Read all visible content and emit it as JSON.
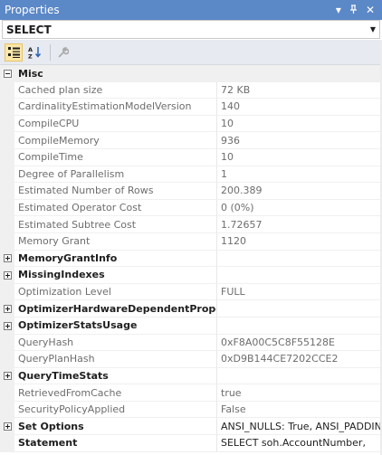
{
  "window": {
    "title": "Properties"
  },
  "selector": {
    "value": "SELECT"
  },
  "category": {
    "label": "Misc"
  },
  "rows": [
    {
      "name": "Cached plan size",
      "value": "72 KB",
      "kind": "plain"
    },
    {
      "name": "CardinalityEstimationModelVersion",
      "value": "140",
      "kind": "plain"
    },
    {
      "name": "CompileCPU",
      "value": "10",
      "kind": "plain"
    },
    {
      "name": "CompileMemory",
      "value": "936",
      "kind": "plain"
    },
    {
      "name": "CompileTime",
      "value": "10",
      "kind": "plain"
    },
    {
      "name": "Degree of Parallelism",
      "value": "1",
      "kind": "plain"
    },
    {
      "name": "Estimated Number of Rows",
      "value": "200.389",
      "kind": "plain"
    },
    {
      "name": "Estimated Operator Cost",
      "value": "0 (0%)",
      "kind": "plain"
    },
    {
      "name": "Estimated Subtree Cost",
      "value": "1.72657",
      "kind": "plain"
    },
    {
      "name": "Memory Grant",
      "value": "1120",
      "kind": "plain"
    },
    {
      "name": "MemoryGrantInfo",
      "value": "",
      "kind": "expandable"
    },
    {
      "name": "MissingIndexes",
      "value": "",
      "kind": "expandable"
    },
    {
      "name": "Optimization Level",
      "value": "FULL",
      "kind": "plain"
    },
    {
      "name": "OptimizerHardwareDependentProperties",
      "value": "",
      "kind": "expandable"
    },
    {
      "name": "OptimizerStatsUsage",
      "value": "",
      "kind": "expandable"
    },
    {
      "name": "QueryHash",
      "value": "0xF8A00C5C8F55128E",
      "kind": "plain"
    },
    {
      "name": "QueryPlanHash",
      "value": "0xD9B144CE7202CCE2",
      "kind": "plain"
    },
    {
      "name": "QueryTimeStats",
      "value": "",
      "kind": "expandable"
    },
    {
      "name": "RetrievedFromCache",
      "value": "true",
      "kind": "plain"
    },
    {
      "name": "SecurityPolicyApplied",
      "value": "False",
      "kind": "plain"
    },
    {
      "name": "Set Options",
      "value": "ANSI_NULLS: True, ANSI_PADDING",
      "kind": "expandable-value"
    },
    {
      "name": "Statement",
      "value": "SELECT soh.AccountNumber,",
      "kind": "editable"
    }
  ],
  "icons": {
    "categorized": "categorized-icon",
    "alphabetical": "sort-alphabetical-icon",
    "property_pages": "wrench-icon"
  }
}
